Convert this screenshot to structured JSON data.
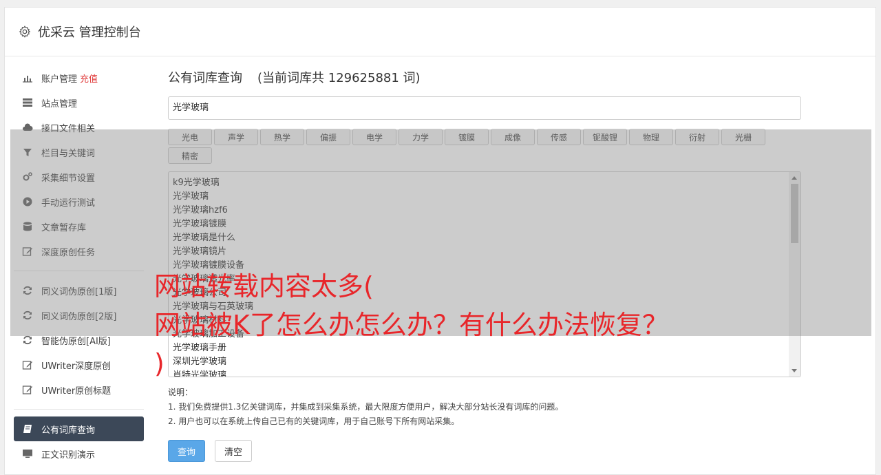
{
  "header": {
    "title": "优采云 管理控制台"
  },
  "sidebar": {
    "items": [
      {
        "label": "账户管理",
        "badge": "充值"
      },
      {
        "label": "站点管理"
      },
      {
        "label": "接口文件相关"
      },
      {
        "label": "栏目与关键词"
      },
      {
        "label": "采集细节设置"
      },
      {
        "label": "手动运行测试"
      },
      {
        "label": "文章暂存库"
      },
      {
        "label": "深度原创任务"
      },
      {
        "label": "同义词伪原创[1版]"
      },
      {
        "label": "同义词伪原创[2版]"
      },
      {
        "label": "智能伪原创[AI版]"
      },
      {
        "label": "UWriter深度原创"
      },
      {
        "label": "UWriter原创标题"
      },
      {
        "label": "公有词库查询"
      },
      {
        "label": "正文识别演示"
      }
    ]
  },
  "main": {
    "title": "公有词库查询",
    "count_text": "(当前词库共 129625881 词)",
    "search_value": "光学玻璃",
    "tags": [
      "光电",
      "声学",
      "热学",
      "偏振",
      "电学",
      "力学",
      "镀膜",
      "成像",
      "传感",
      "铌酸锂",
      "物理",
      "衍射",
      "光栅",
      "精密"
    ],
    "results": [
      "k9光学玻璃",
      "光学玻璃",
      "光学玻璃hzf6",
      "光学玻璃镀膜",
      "光学玻璃是什么",
      "光学玻璃镜片",
      "光学玻璃镀膜设备",
      "光学玻璃透光率",
      "光学玻璃公司",
      "光学玻璃与石英玻璃",
      "光学玻璃材料",
      "光学玻璃加工设备",
      "光学玻璃手册",
      "深圳光学玻璃",
      "肖特光学玻璃"
    ],
    "notes": [
      "说明：",
      "1. 我们免费提供1.3亿关键词库，并集成到采集系统，最大限度方便用户，解决大部分站长没有词库的问题。",
      "2. 用户也可以在系统上传自己已有的关键词库，用于自己账号下所有网站采集。"
    ],
    "buttons": {
      "query": "查询",
      "clear": "清空"
    }
  },
  "overlay": {
    "line1": "网站转载内容太多(",
    "line2": "网站被K了怎么办怎么办？有什么办法恢复？",
    "line3": ")"
  },
  "colors": {
    "accent": "#5aa7e8",
    "active_nav": "#3c4858",
    "badge": "#e03b3b",
    "headline": "#e8262a"
  }
}
